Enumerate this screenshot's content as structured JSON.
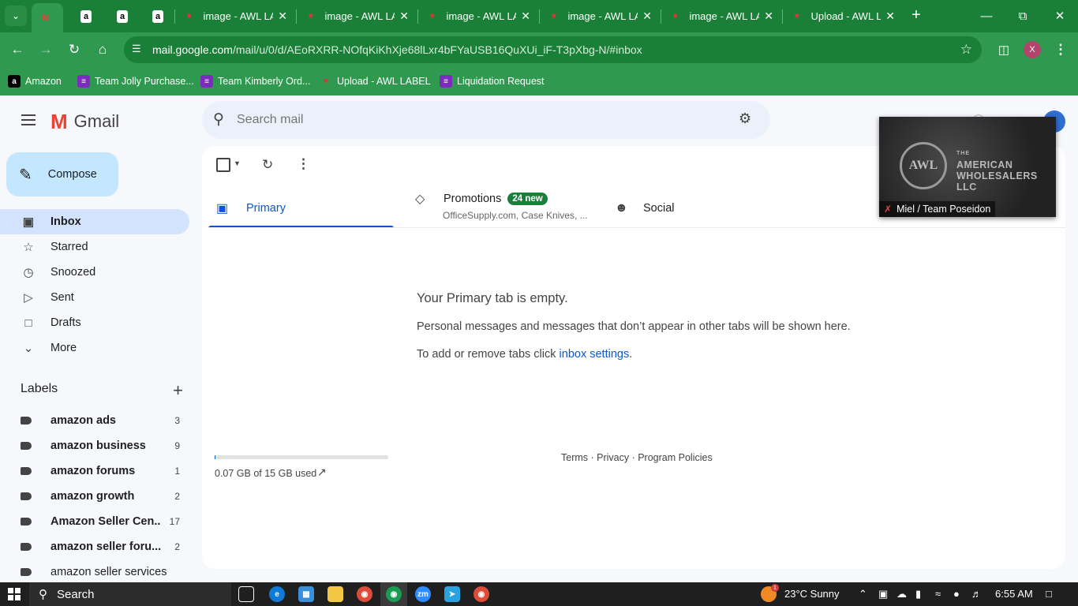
{
  "browser": {
    "tabs": [
      {
        "title": "",
        "favicon": "gmail-icon",
        "active": true
      },
      {
        "title": "",
        "favicon": "amazon-icon"
      },
      {
        "title": "",
        "favicon": "amazon-icon"
      },
      {
        "title": "",
        "favicon": "amazon-icon"
      },
      {
        "title": "image - AWL LA",
        "favicon": "awl-icon"
      },
      {
        "title": "image - AWL LA",
        "favicon": "awl-icon"
      },
      {
        "title": "image - AWL LA",
        "favicon": "awl-icon"
      },
      {
        "title": "image - AWL LA",
        "favicon": "awl-icon"
      },
      {
        "title": "image - AWL LA",
        "favicon": "awl-icon"
      },
      {
        "title": "Upload - AWL L",
        "favicon": "awl-icon"
      }
    ],
    "url_host": "mail.google.com",
    "url_path": "/mail/u/0/d/AEoRXRR-NOfqKiKhXje68lLxr4bFYaUSB16QuXUi_iF-T3pXbg-N/#inbox",
    "profile_initial": "X",
    "bookmarks": [
      {
        "label": "Amazon",
        "icon": "amazon-icon"
      },
      {
        "label": "Team Jolly Purchase...",
        "icon": "list-icon"
      },
      {
        "label": "Team Kimberly Ord...",
        "icon": "list-icon"
      },
      {
        "label": "Upload - AWL LABEL",
        "icon": "awl-icon"
      },
      {
        "label": "Liquidation Request",
        "icon": "list-icon"
      }
    ],
    "accent": "#1a7f37"
  },
  "gmail": {
    "brand": "Gmail",
    "search_placeholder": "Search mail",
    "compose": "Compose",
    "nav": [
      {
        "label": "Inbox",
        "icon": "inbox-icon",
        "active": true
      },
      {
        "label": "Starred",
        "icon": "star-icon"
      },
      {
        "label": "Snoozed",
        "icon": "clock-icon"
      },
      {
        "label": "Sent",
        "icon": "send-icon"
      },
      {
        "label": "Drafts",
        "icon": "draft-icon"
      },
      {
        "label": "More",
        "icon": "chevron-down-icon"
      }
    ],
    "labels_title": "Labels",
    "labels": [
      {
        "name": "amazon ads",
        "count": "3"
      },
      {
        "name": "amazon business",
        "count": "9"
      },
      {
        "name": "amazon forums",
        "count": "1"
      },
      {
        "name": "amazon growth",
        "count": "2"
      },
      {
        "name": "Amazon Seller Cen...",
        "count": "17"
      },
      {
        "name": "amazon seller foru...",
        "count": "2"
      },
      {
        "name": "amazon seller services",
        "count": ""
      }
    ],
    "tabs": {
      "primary": "Primary",
      "promotions": "Promotions",
      "promotions_badge": "24 new",
      "promotions_sub": "OfficeSupply.com, Case Knives, ...",
      "social": "Social"
    },
    "empty": {
      "title": "Your Primary tab is empty.",
      "subtitle": "Personal messages and messages that don’t appear in other tabs will be shown here.",
      "hint_prefix": "To add or remove tabs click ",
      "hint_link": "inbox settings",
      "hint_suffix": "."
    },
    "storage": {
      "text": "0.07 GB of 15 GB used",
      "fraction": 0.005
    },
    "footer": "Terms · Privacy · Program Policies"
  },
  "pip": {
    "logo_text": "AWL",
    "brand_small": "THE",
    "brand_line1": "AMERICAN",
    "brand_line2": "WHOLESALERS",
    "brand_line3": "LLC",
    "caption": "Miel / Team Poseidon"
  },
  "taskbar": {
    "search": "Search",
    "weather_badge": "1",
    "weather": "23°C  Sunny",
    "time": "6:55 AM"
  }
}
